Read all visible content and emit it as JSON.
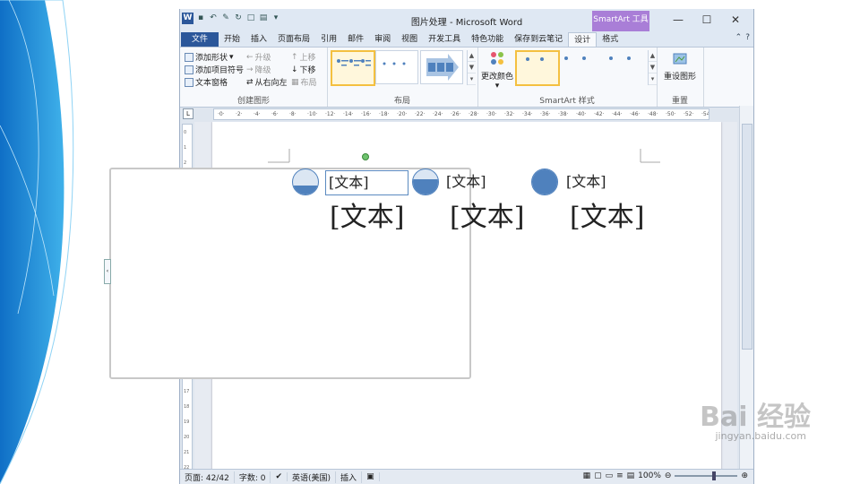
{
  "window": {
    "title": "图片处理 - Microsoft Word",
    "contextual_tab_group": "SmartArt 工具",
    "app_icon": "W"
  },
  "tabs": [
    "文件",
    "开始",
    "插入",
    "页面布局",
    "引用",
    "邮件",
    "审阅",
    "视图",
    "开发工具",
    "特色功能",
    "保存到云笔记",
    "设计",
    "格式"
  ],
  "ribbon": {
    "create_graphic": {
      "label": "创建图形",
      "add_shape": "添加形状",
      "add_bullet": "添加项目符号",
      "text_pane": "文本窗格",
      "promote": "升级",
      "demote": "降级",
      "right_to_left": "从右向左",
      "move_up": "上移",
      "move_down": "下移",
      "layout": "布局"
    },
    "layouts": {
      "label": "布局"
    },
    "styles": {
      "label": "SmartArt 样式",
      "change_colors": "更改颜色"
    },
    "reset": {
      "label": "重置",
      "reset_graphic": "重设图形"
    }
  },
  "smartart": {
    "small_labels": [
      "[文本]",
      "[文本]",
      "[文本]"
    ],
    "big_labels": [
      "[文本]",
      "[文本]",
      "[文本]"
    ],
    "fill_levels": [
      0.35,
      0.6,
      1.0
    ]
  },
  "statusbar": {
    "page": "页面: 42/42",
    "words": "字数: 0",
    "language": "英语(美国)",
    "mode": "插入",
    "zoom": "100%"
  },
  "watermark": {
    "brand": "Bai 经验",
    "url": "jingyan.baidu.com"
  },
  "colors": {
    "file_tab": "#2b579a",
    "contextual": "#a97ed7",
    "shape_fill": "#4f81bd"
  }
}
